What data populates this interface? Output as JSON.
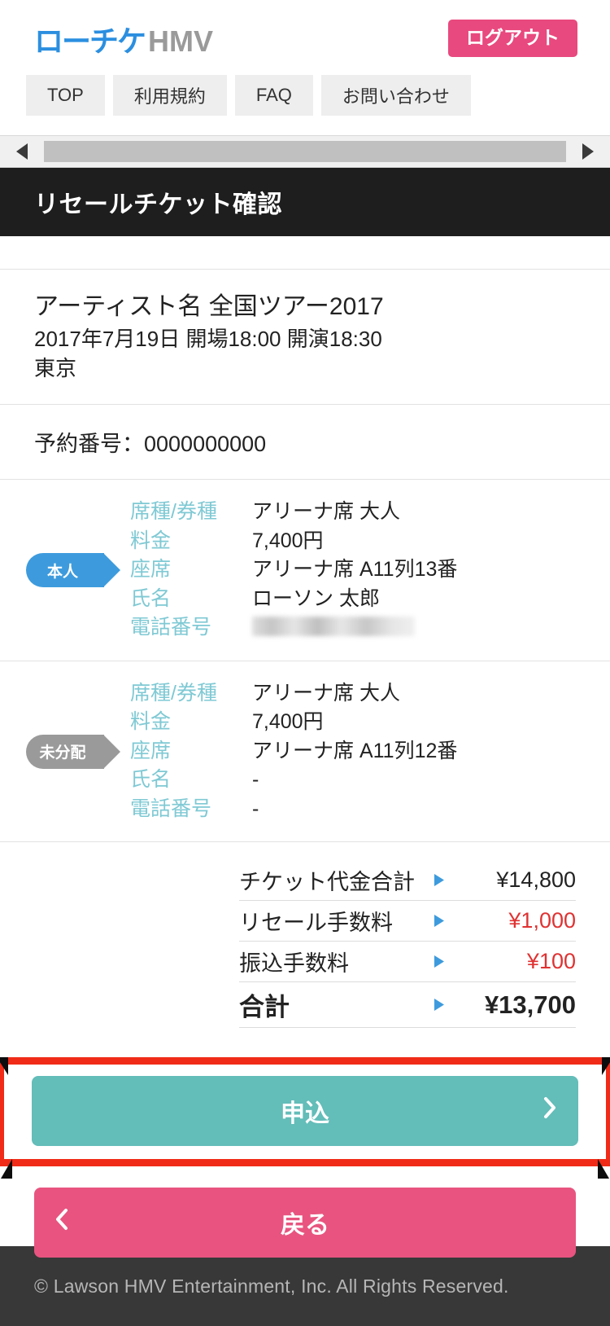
{
  "header": {
    "logo_jp": "ローチケ",
    "logo_en": "HMV",
    "logout_label": "ログアウト"
  },
  "nav": {
    "items": [
      {
        "label": "TOP"
      },
      {
        "label": "利用規約"
      },
      {
        "label": "FAQ"
      },
      {
        "label": "お問い合わせ"
      }
    ]
  },
  "page": {
    "title": "リセールチケット確認"
  },
  "event": {
    "title": "アーティスト名 全国ツアー2017",
    "datetime": "2017年7月19日 開場18:00 開演18:30",
    "venue": "東京"
  },
  "reservation": {
    "label": "予約番号：0000000000"
  },
  "tickets": [
    {
      "badge": "本人",
      "badge_type": "self",
      "fields": [
        {
          "label": "席種/券種",
          "value": "アリーナ席 大人"
        },
        {
          "label": "料金",
          "value": "7,400円"
        },
        {
          "label": "座席",
          "value": "アリーナ席 A11列13番"
        },
        {
          "label": "氏名",
          "value": "ローソン 太郎"
        },
        {
          "label": "電話番号",
          "value": "",
          "masked": true
        }
      ]
    },
    {
      "badge": "未分配",
      "badge_type": "unassigned",
      "fields": [
        {
          "label": "席種/券種",
          "value": "アリーナ席 大人"
        },
        {
          "label": "料金",
          "value": "7,400円"
        },
        {
          "label": "座席",
          "value": "アリーナ席 A11列12番"
        },
        {
          "label": "氏名",
          "value": "-"
        },
        {
          "label": "電話番号",
          "value": "-"
        }
      ]
    }
  ],
  "summary": {
    "rows": [
      {
        "label": "チケット代金合計",
        "value": "¥14,800",
        "style": "normal"
      },
      {
        "label": "リセール手数料",
        "value": "¥1,000",
        "style": "fee"
      },
      {
        "label": "振込手数料",
        "value": "¥100",
        "style": "fee"
      },
      {
        "label": "合計",
        "value": "¥13,700",
        "style": "total"
      }
    ]
  },
  "actions": {
    "apply_label": "申込",
    "back_label": "戻る"
  },
  "footer": {
    "copyright": "© Lawson HMV Entertainment, Inc. All Rights Reserved."
  },
  "colors": {
    "brand_blue": "#2b8fe0",
    "accent_pink": "#e8497e",
    "apply_teal": "#63bdb9",
    "back_pink": "#e8547f",
    "highlight_red": "#f02b18",
    "label_teal": "#7fc9d4",
    "fee_red": "#e03232",
    "title_bar": "#1e1e1e",
    "footer_bg": "#383838"
  }
}
